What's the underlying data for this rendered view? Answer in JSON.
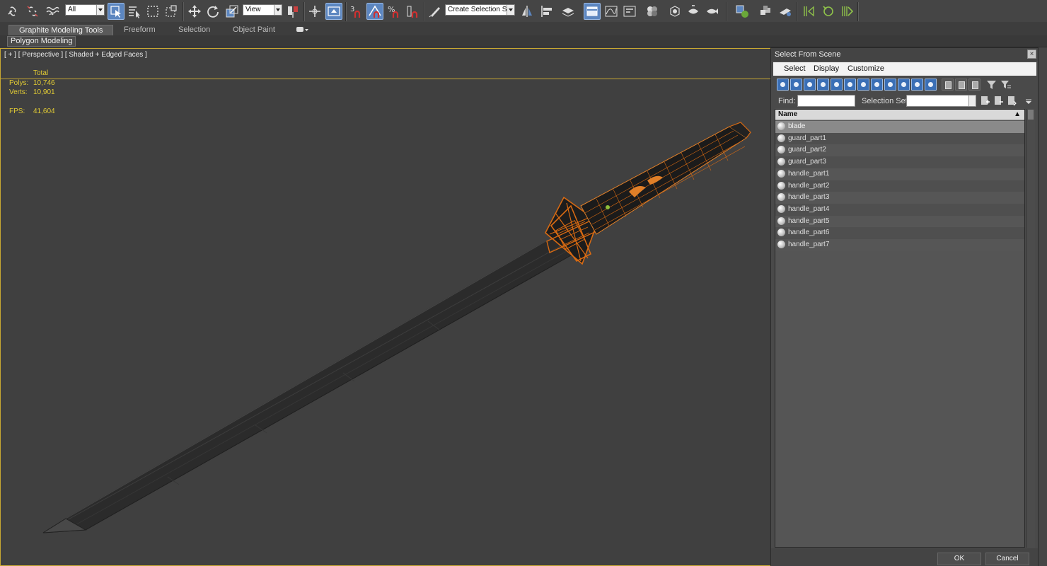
{
  "toolbar": {
    "filter_combo": "All",
    "view_combo": "View",
    "snap_angle": "3",
    "snap_percent": "%",
    "selection_set_placeholder": "Create Selection Se"
  },
  "ribbon": {
    "tabs": [
      "Graphite Modeling Tools",
      "Freeform",
      "Selection",
      "Object Paint"
    ],
    "panel_label": "Polygon Modeling"
  },
  "viewport": {
    "label": "[ + ] [ Perspective ] [ Shaded + Edged Faces ]",
    "stats": {
      "total_label": "Total",
      "polys_label": "Polys:",
      "polys_value": "10,746",
      "verts_label": "Verts:",
      "verts_value": "10,901",
      "fps_label": "FPS:",
      "fps_value": "41,604"
    }
  },
  "dialog": {
    "title": "Select From Scene",
    "close_glyph": "×",
    "menu": [
      "Select",
      "Display",
      "Customize"
    ],
    "find_label": "Find:",
    "selection_set_label": "Selection Set:",
    "column_name": "Name",
    "sort_glyph": "▲",
    "objects": [
      "blade",
      "guard_part1",
      "guard_part2",
      "guard_part3",
      "handle_part1",
      "handle_part2",
      "handle_part3",
      "handle_part4",
      "handle_part5",
      "handle_part6",
      "handle_part7"
    ],
    "selected_index": 0,
    "ok_label": "OK",
    "cancel_label": "Cancel"
  },
  "colors": {
    "stat_text": "#e3cc34",
    "viewport_border": "#c8a832",
    "guard_wire": "#d86a12",
    "selection_blue": "#5c86c0"
  }
}
